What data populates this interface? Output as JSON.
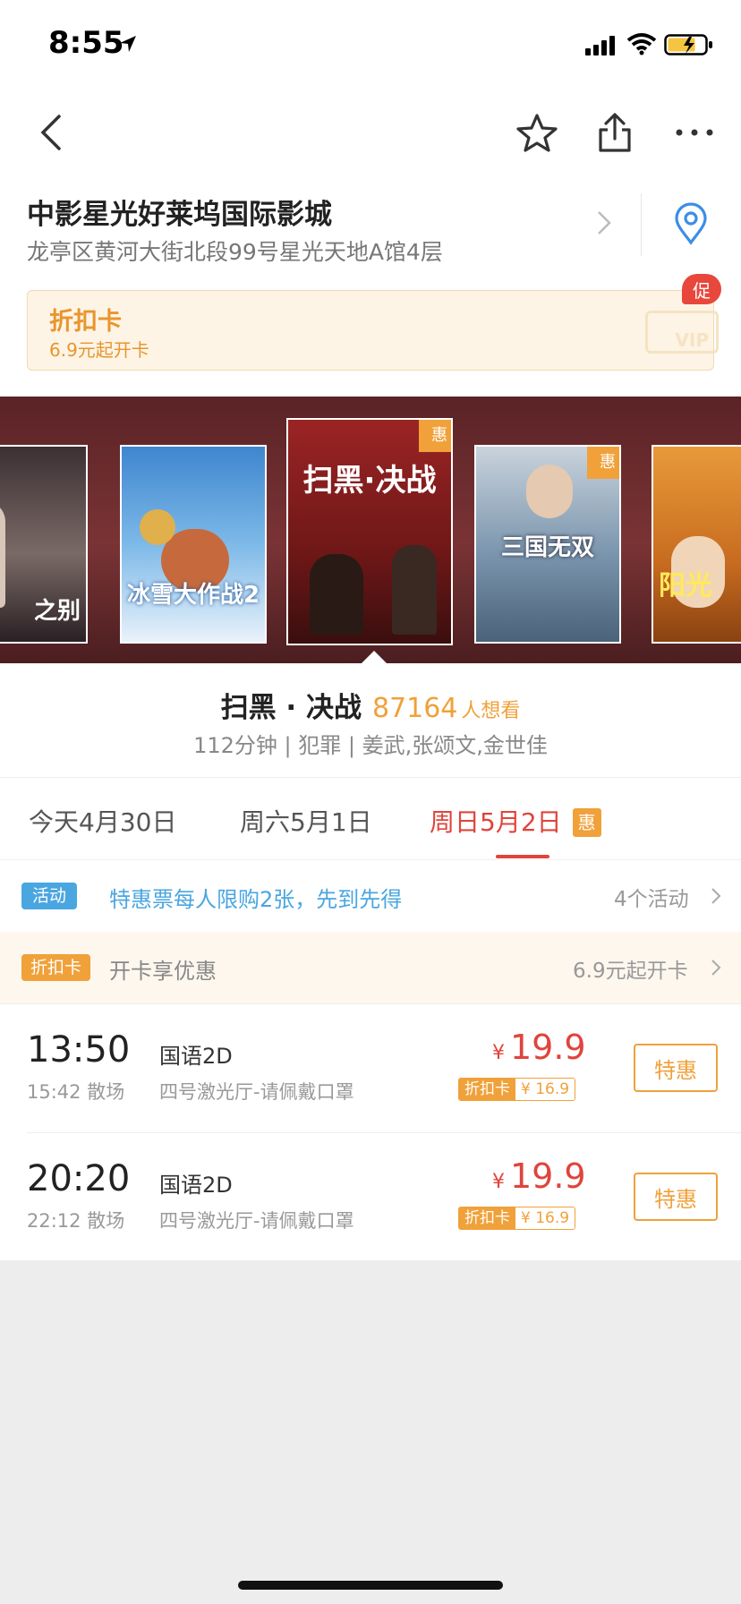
{
  "status": {
    "time": "8:55"
  },
  "cinema": {
    "name": "中影星光好莱坞国际影城",
    "address": "龙亭区黄河大街北段99号星光天地A馆4层",
    "card": {
      "title": "折扣卡",
      "subtitle": "6.9元起开卡",
      "vip": "VIP",
      "promo": "促"
    }
  },
  "posters": [
    {
      "title": "之别",
      "bg": "#3c3034",
      "accent": "#d8c6b8"
    },
    {
      "title": "冰雪大作战2",
      "bg": "#5a9bd6",
      "accent": "#ffffff"
    },
    {
      "title": "扫黑·决战",
      "bg": "#7a1f1f",
      "accent": "#ffffff",
      "hui": "惠"
    },
    {
      "title": "三国无双",
      "bg": "#8aa2b6",
      "accent": "#ffffff",
      "hui": "惠"
    },
    {
      "title": "阳光",
      "bg": "#d98a2b",
      "accent": "#ffea5c"
    }
  ],
  "movie": {
    "title": "扫黑 · 决战",
    "want_count": "87164",
    "want_label": "人想看",
    "meta": "112分钟 | 犯罪 | 姜武,张颂文,金世佳"
  },
  "dates": [
    {
      "label": "今天4月30日"
    },
    {
      "label": "周六5月1日"
    },
    {
      "label": "周日5月2日",
      "badge": "惠"
    }
  ],
  "activity": {
    "tag": "活动",
    "text": "特惠票每人限购2张，先到先得",
    "count": "4个活动"
  },
  "discount": {
    "tag": "折扣卡",
    "text": "开卡享优惠",
    "right": "6.9元起开卡"
  },
  "shows": [
    {
      "time": "13:50",
      "end": "15:42 散场",
      "lang": "国语2D",
      "hall": "四号激光厅-请佩戴口罩",
      "currency": "¥",
      "price": "19.9",
      "card_tag": "折扣卡",
      "card_price": "¥ 16.9",
      "button": "特惠"
    },
    {
      "time": "20:20",
      "end": "22:12 散场",
      "lang": "国语2D",
      "hall": "四号激光厅-请佩戴口罩",
      "currency": "¥",
      "price": "19.9",
      "card_tag": "折扣卡",
      "card_price": "¥ 16.9",
      "button": "特惠"
    }
  ],
  "colors": {
    "accent_red": "#e0443b",
    "accent_orange": "#f0a13a",
    "activity_blue": "#4aa6e0"
  },
  "icons": [
    "back-icon",
    "star-icon",
    "share-icon",
    "more-icon",
    "location-pin-icon",
    "chevron-right-icon"
  ]
}
